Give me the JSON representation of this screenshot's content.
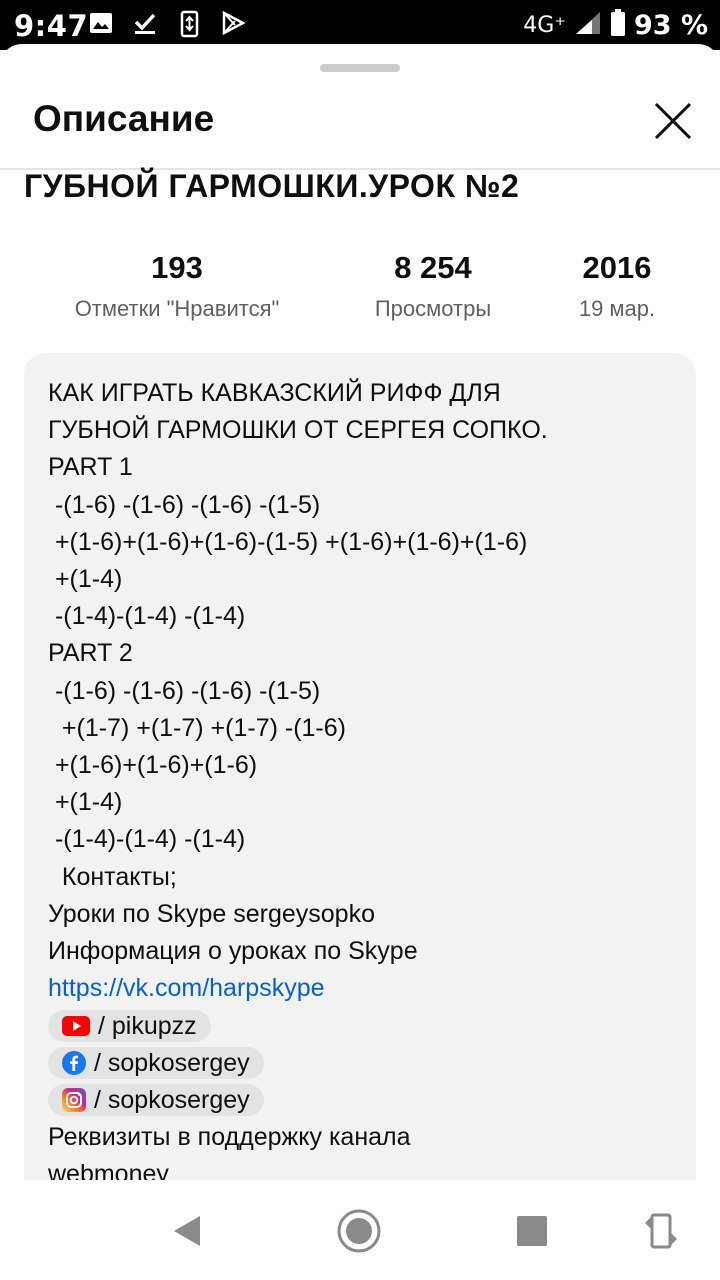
{
  "status_bar": {
    "time": "9:47",
    "network": "4G⁺",
    "battery": "93 %",
    "notification_icons": [
      "image-icon",
      "download-done-icon",
      "screen-rotate-icon",
      "play-store-icon"
    ]
  },
  "sheet": {
    "title": "Описание",
    "close_icon": "close-icon"
  },
  "video": {
    "title": "ГУБНОЙ ГАРМОШКИ.УРОК №2"
  },
  "stats": [
    {
      "value": "193",
      "label": "Отметки \"Нравится\""
    },
    {
      "value": "8 254",
      "label": "Просмотры"
    },
    {
      "value": "2016",
      "label": "19 мар."
    }
  ],
  "description": {
    "lines": [
      "КАК ИГРАТЬ КАВКАЗСКИЙ РИФФ ДЛЯ",
      "ГУБНОЙ ГАРМОШКИ ОТ СЕРГЕЯ СОПКО.",
      "PART 1",
      " -(1-6) -(1-6) -(1-6) -(1-5)",
      " +(1-6)+(1-6)+(1-6)-(1-5) +(1-6)+(1-6)+(1-6)",
      " +(1-4)",
      " -(1-4)-(1-4) -(1-4)",
      "PART 2",
      " -(1-6) -(1-6) -(1-6) -(1-5)",
      "  +(1-7) +(1-7) +(1-7) -(1-6)",
      " +(1-6)+(1-6)+(1-6)",
      " +(1-4)",
      " -(1-4)-(1-4) -(1-4)",
      "  Контакты;",
      "Уроки по Skype sergeysopko",
      "Информация о уроках по Skype"
    ],
    "link": "https://vk.com/harpskype",
    "chips": [
      {
        "icon": "youtube-icon",
        "text": "/ pikupzz"
      },
      {
        "icon": "facebook-icon",
        "text": "/ sopkosergey"
      },
      {
        "icon": "instagram-icon",
        "text": "/ sopkosergey"
      }
    ],
    "tail_lines": [
      "Реквизиты в поддержку канала",
      "webmoney"
    ]
  },
  "nav_bar": {
    "buttons": [
      "back-icon",
      "home-icon",
      "recents-icon",
      "rotate-icon"
    ]
  },
  "colors": {
    "link": "#065fd4",
    "youtube_red": "#ff0000",
    "facebook_blue": "#1877f2",
    "description_bg": "#f2f2f2"
  }
}
